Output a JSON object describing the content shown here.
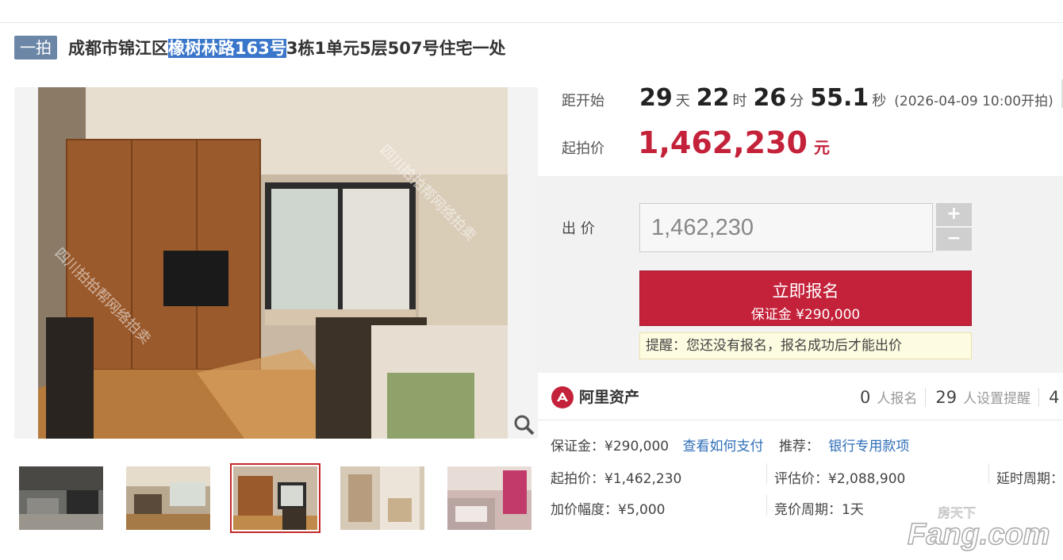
{
  "header": {
    "badge": "一拍",
    "title_before": "成都市锦江区",
    "title_highlight": "橡树林路163号",
    "title_after": "3栋1单元5层507号住宅一处"
  },
  "countdown": {
    "label": "距开始",
    "days": "29",
    "days_unit": "天",
    "hours": "22",
    "hours_unit": "时",
    "minutes": "26",
    "minutes_unit": "分",
    "seconds": "55.1",
    "seconds_unit": "秒",
    "start_note": "(2026-04-09 10:00开拍)"
  },
  "start_price": {
    "label": "起拍价",
    "value": "1,462,230",
    "unit": "元"
  },
  "bid": {
    "label": "出 价",
    "input_value": "1,462,230",
    "plus": "+",
    "minus": "−",
    "signup_label": "立即报名",
    "deposit_label": "保证金 ¥290,000",
    "reminder": "提醒：您还没有报名，报名成功后才能出价"
  },
  "platform": {
    "name": "阿里资产",
    "signups_count": "0",
    "signups_label": "人报名",
    "reminders_count": "29",
    "reminders_label": "人设置提醒",
    "views_count": "4"
  },
  "details": {
    "deposit": "保证金：¥290,000",
    "how_to_pay": "查看如何支付",
    "recommend_label": "推荐：",
    "recommend_link": "银行专用款项",
    "start_price": "起拍价：¥1,462,230",
    "appraisal": "评估价：¥2,088,900",
    "delay": "延时周期：",
    "increment": "加价幅度：¥5,000",
    "cycle": "竞价周期：1天"
  },
  "photo_watermark": "四川拍拍帮网络拍卖",
  "watermark": {
    "line1": "房天下",
    "line2": "Fang.com"
  },
  "colors": {
    "accent_red": "#c4223a",
    "badge_blue": "#6b86a6",
    "link_blue": "#2e6eb8"
  }
}
